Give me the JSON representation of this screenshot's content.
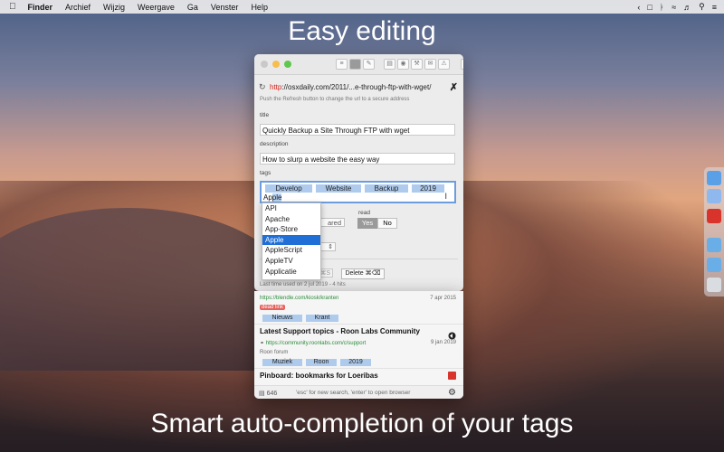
{
  "menubar": {
    "apple_icon": "",
    "items": [
      "Finder",
      "Archief",
      "Wijzig",
      "Weergave",
      "Ga",
      "Venster",
      "Help"
    ]
  },
  "headline_top": "Easy editing",
  "headline_bottom": "Smart auto-completion of your tags",
  "editor": {
    "url_prefix": "http",
    "url_rest": "://osxdaily.com/2011/...e-through-ftp-with-wget/",
    "hint": "Push the Refresh button to change the url to a secure address",
    "title_label": "title",
    "title_value": "Quickly Backup a Site Through FTP with wget",
    "description_label": "description",
    "description_value": "How to slurp a website the easy way",
    "tags_label": "tags",
    "tags": [
      "Develop",
      "Website",
      "Backup",
      "2019"
    ],
    "typed_plain": "Ap",
    "typed_selected": "ple",
    "shared_label": "ared",
    "read_label": "read",
    "read_yes": "Yes",
    "read_no": "No",
    "faded_button": "⌘S",
    "delete_button": "Delete ⌘⌫",
    "last_used": "Last time used on 2 jul 2019 - 4 hits"
  },
  "autocomplete": [
    "API",
    "Apache",
    "App-Store",
    "Apple",
    "AppleScript",
    "AppleTV",
    "Applicatie"
  ],
  "autocomplete_active": "Apple",
  "results": {
    "r1": {
      "url": "https://blendle.com/kiosk/kranten",
      "date": "7 apr 2015",
      "badge": "dead link",
      "tags": [
        "Nieuws",
        "Krant"
      ]
    },
    "r2": {
      "title": "Latest Support topics - Roon Labs Community",
      "url": "https://community.roonlabs.com/c/support",
      "date": "9 jan 2019",
      "description": "Roon forum",
      "tags": [
        "Muziek",
        "Roon",
        "2019"
      ]
    },
    "r3": {
      "title": "Pinboard: bookmarks for Loeribas"
    },
    "footer_count": "646",
    "footer_hint": "'esc' for new search, 'enter' to open browser"
  }
}
